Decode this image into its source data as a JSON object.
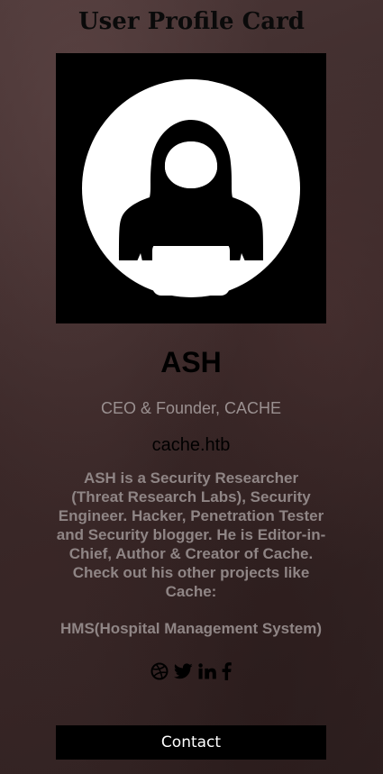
{
  "page": {
    "title": "User Profile Card"
  },
  "profile": {
    "name": "ASH",
    "role": "CEO & Founder, CACHE",
    "site": "cache.htb",
    "bio": "ASH is a Security Researcher (Threat Research Labs), Security Engineer. Hacker, Penetration Tester and Security blogger. He is Editor-in-Chief, Author & Creator of Cache. Check out his other projects like Cache:",
    "projects": "HMS(Hospital Management System)"
  },
  "social": [
    {
      "icon": "dribbble-icon"
    },
    {
      "icon": "twitter-icon"
    },
    {
      "icon": "linkedin-icon"
    },
    {
      "icon": "facebook-icon"
    }
  ],
  "contact": {
    "label": "Contact"
  },
  "colors": {
    "background": "#3b2a2a",
    "card_button": "#000000",
    "muted_text": "#9a9090"
  }
}
